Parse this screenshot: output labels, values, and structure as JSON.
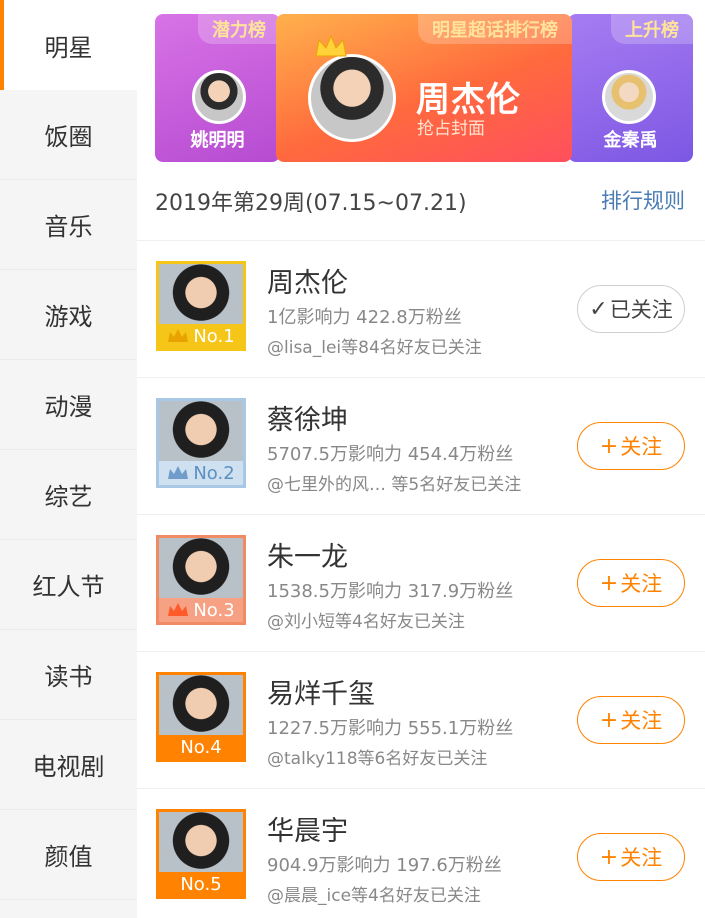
{
  "sidebar": {
    "items": [
      {
        "label": "明星",
        "active": true
      },
      {
        "label": "饭圈"
      },
      {
        "label": "音乐"
      },
      {
        "label": "游戏"
      },
      {
        "label": "动漫"
      },
      {
        "label": "综艺"
      },
      {
        "label": "红人节"
      },
      {
        "label": "读书"
      },
      {
        "label": "电视剧"
      },
      {
        "label": "颜值"
      }
    ]
  },
  "banners": {
    "left": {
      "tag": "潜力榜",
      "name": "姚明明"
    },
    "center": {
      "tag": "明星超话排行榜",
      "name": "周杰伦",
      "subtitle": "抢占封面"
    },
    "right": {
      "tag": "上升榜",
      "name": "金秦禹"
    }
  },
  "week": {
    "label": "2019年第29周(07.15~07.21)",
    "rules_link": "排行规则"
  },
  "rank_colors": {
    "gold": "#f5c518",
    "silver": "#a9c8e6",
    "bronze": "#f08b63",
    "default": "#ff8200"
  },
  "list": [
    {
      "rank": "No.1",
      "name": "周杰伦",
      "stats": "1亿影响力 422.8万粉丝",
      "friends": "@lisa_lei等84名好友已关注",
      "button": "已关注",
      "button_icon": "✓",
      "followed": true
    },
    {
      "rank": "No.2",
      "name": "蔡徐坤",
      "stats": "5707.5万影响力 454.4万粉丝",
      "friends": "@七里外的风…  等5名好友已关注",
      "button": "关注",
      "button_icon": "+",
      "followed": false
    },
    {
      "rank": "No.3",
      "name": "朱一龙",
      "stats": "1538.5万影响力 317.9万粉丝",
      "friends": "@刘小短等4名好友已关注",
      "button": "关注",
      "button_icon": "+",
      "followed": false
    },
    {
      "rank": "No.4",
      "name": "易烊千玺",
      "stats": "1227.5万影响力 555.1万粉丝",
      "friends": "@talky118等6名好友已关注",
      "button": "关注",
      "button_icon": "+",
      "followed": false
    },
    {
      "rank": "No.5",
      "name": "华晨宇",
      "stats": "904.9万影响力 197.6万粉丝",
      "friends": "@晨晨_ice等4名好友已关注",
      "button": "关注",
      "button_icon": "+",
      "followed": false
    }
  ]
}
